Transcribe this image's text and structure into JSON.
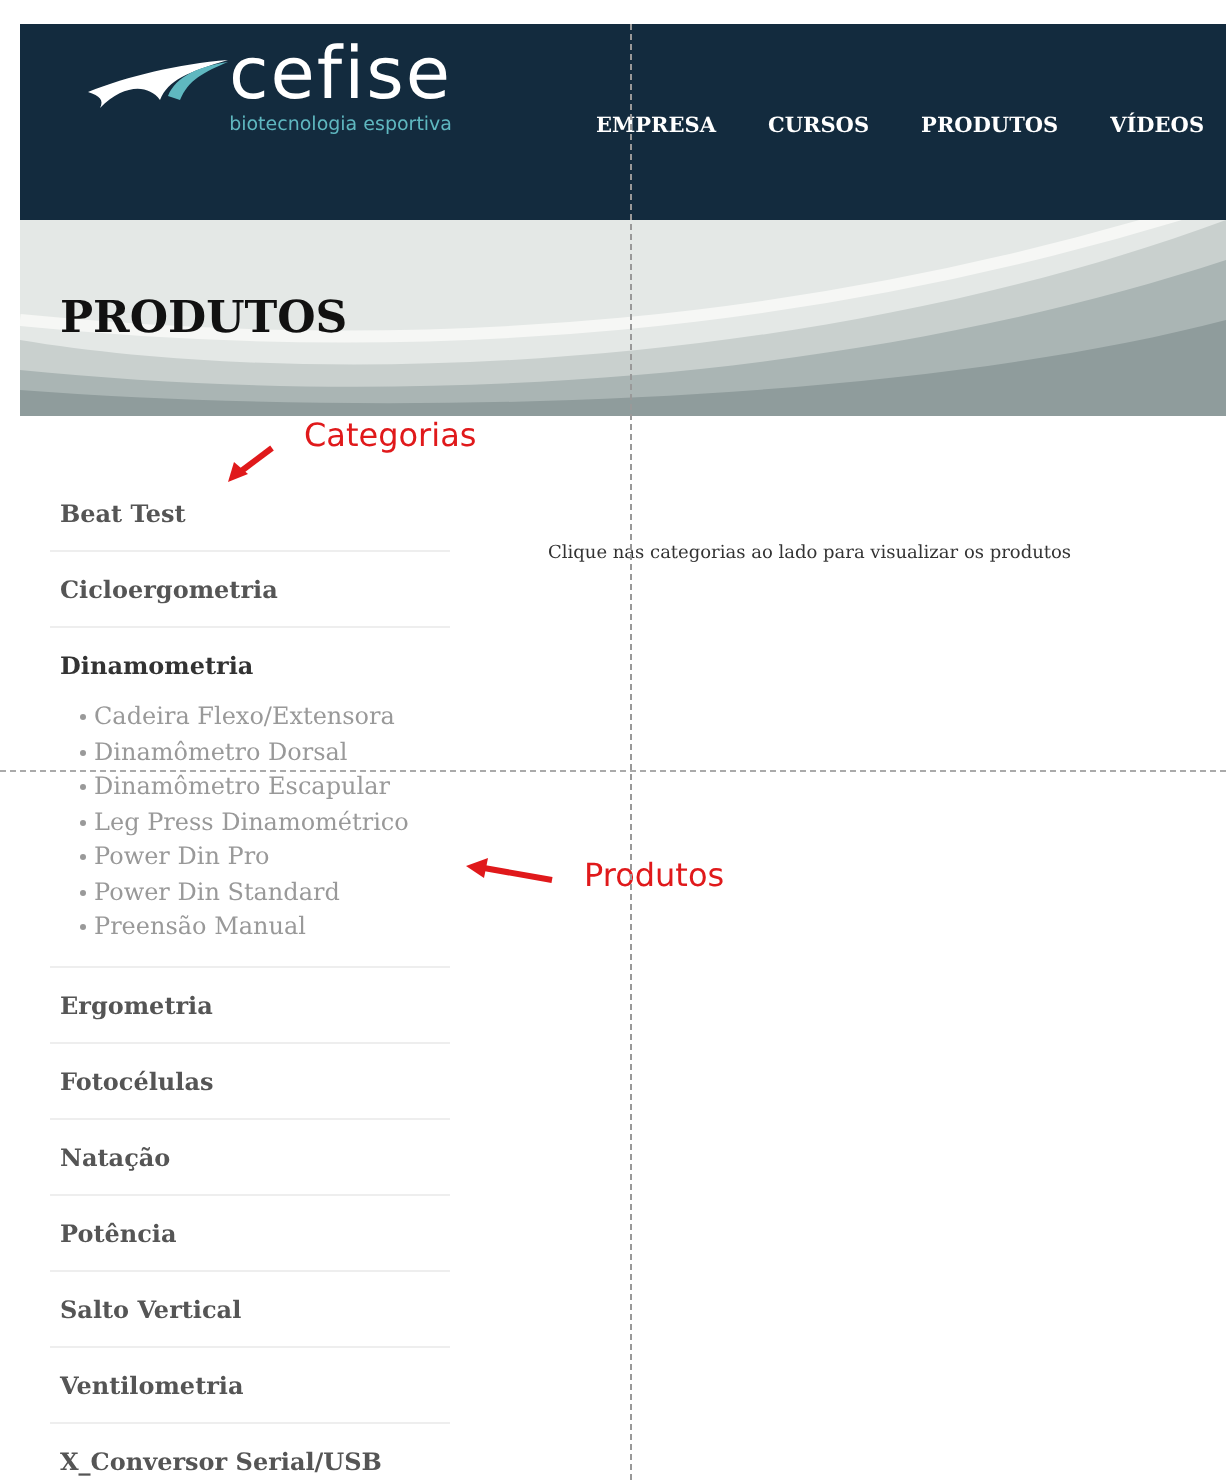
{
  "header": {
    "logo": {
      "name": "cefise",
      "tagline": "biotecnologia esportiva"
    },
    "nav": [
      {
        "label": "EMPRESA",
        "selected": false
      },
      {
        "label": "CURSOS",
        "selected": false
      },
      {
        "label": "PRODUTOS",
        "selected": false
      },
      {
        "label": "VÍDEOS",
        "selected": false
      }
    ]
  },
  "banner": {
    "title": "PRODUTOS"
  },
  "sidebar": {
    "categories": [
      {
        "label": "Beat Test"
      },
      {
        "label": "Cicloergometria"
      },
      {
        "label": "Dinamometria",
        "expanded": true,
        "children": [
          {
            "label": "Cadeira Flexo/Extensora"
          },
          {
            "label": "Dinamômetro Dorsal"
          },
          {
            "label": "Dinamômetro Escapular"
          },
          {
            "label": "Leg Press Dinamométrico"
          },
          {
            "label": "Power Din Pro"
          },
          {
            "label": "Power Din Standard"
          },
          {
            "label": "Preensão Manual"
          }
        ]
      },
      {
        "label": "Ergometria"
      },
      {
        "label": "Fotocélulas"
      },
      {
        "label": "Natação"
      },
      {
        "label": "Potência"
      },
      {
        "label": "Salto Vertical"
      },
      {
        "label": "Ventilometria"
      },
      {
        "label": "X_Conversor Serial/USB"
      }
    ]
  },
  "content": {
    "message": "Clique nas categorias ao lado para visualizar os produtos"
  },
  "annotations": [
    {
      "text": "Categorias"
    },
    {
      "text": "Produtos"
    }
  ]
}
